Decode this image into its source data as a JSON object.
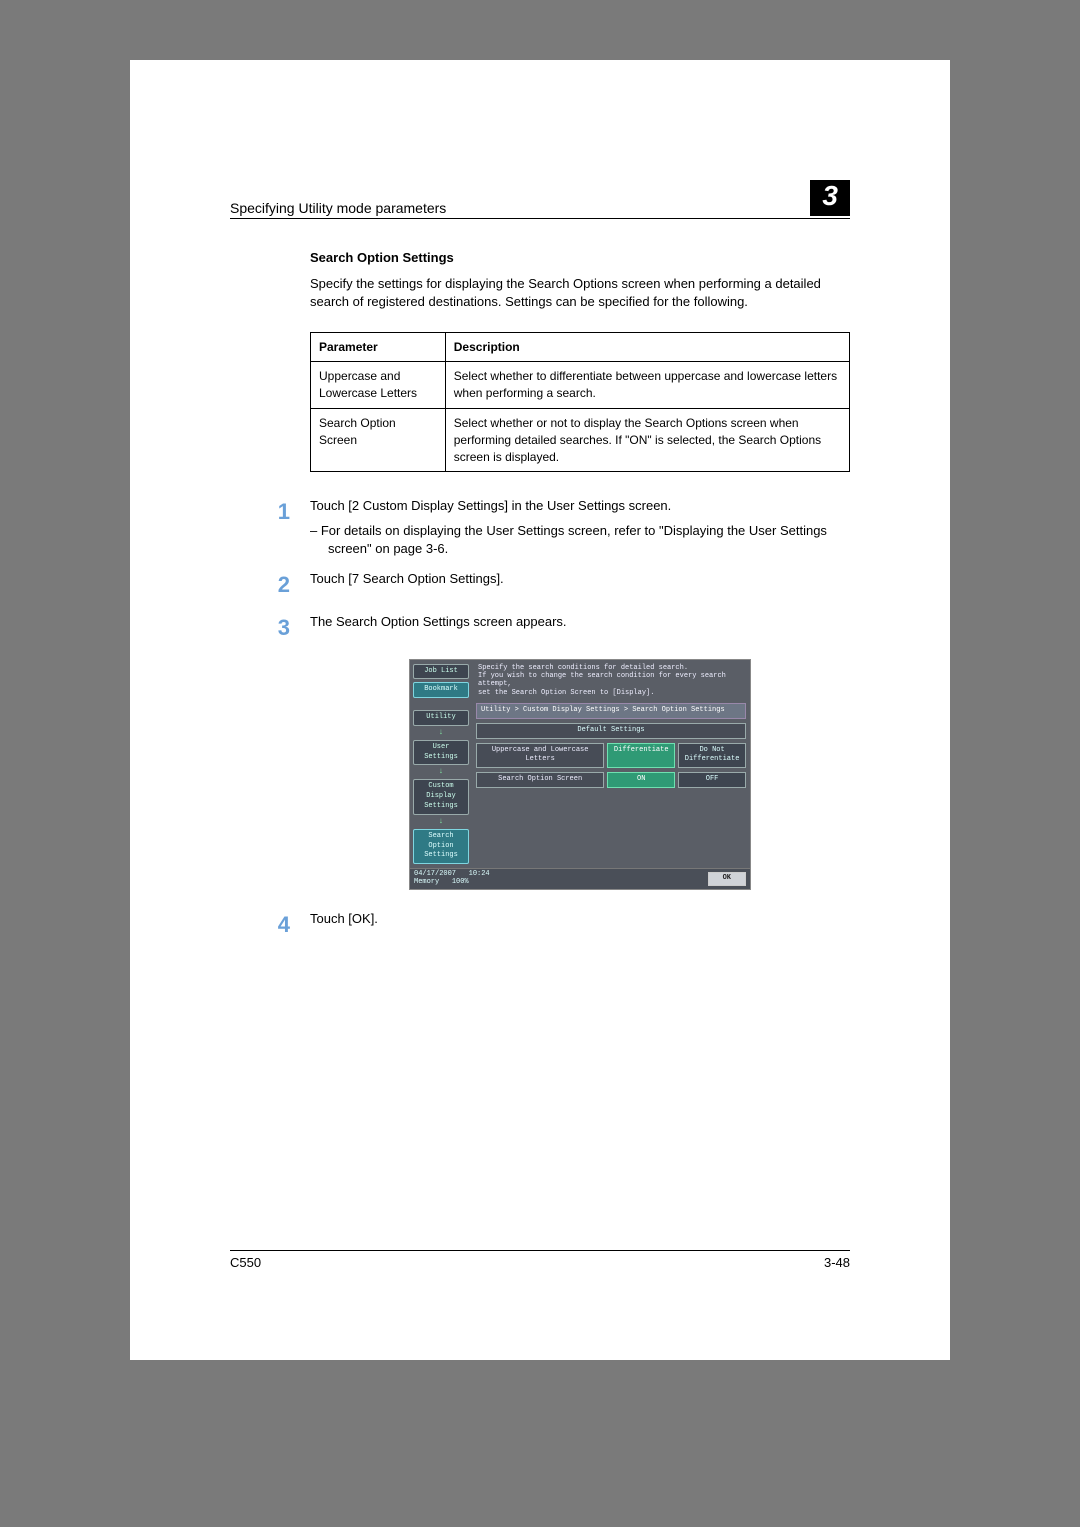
{
  "header": {
    "title": "Specifying Utility mode parameters",
    "chapter": "3"
  },
  "section": {
    "title": "Search Option Settings",
    "intro": "Specify the settings for displaying the Search Options screen when performing a detailed search of registered destinations. Settings can be specified for the following."
  },
  "table": {
    "head_param": "Parameter",
    "head_desc": "Description",
    "rows": [
      {
        "param": "Uppercase and Lowercase Letters",
        "desc": "Select whether to differentiate between uppercase and lowercase letters when performing a search."
      },
      {
        "param": "Search Option Screen",
        "desc": "Select whether or not to display the Search Options screen when performing detailed searches. If \"ON\" is selected, the Search Options screen is displayed."
      }
    ]
  },
  "steps": [
    {
      "num": "1",
      "text": "Touch [2 Custom Display Settings] in the User Settings screen.",
      "sub": "For details on displaying the User Settings screen, refer to \"Displaying the User Settings screen\" on page 3-6."
    },
    {
      "num": "2",
      "text": "Touch [7 Search Option Settings]."
    },
    {
      "num": "3",
      "text": "The Search Option Settings screen appears."
    },
    {
      "num": "4",
      "text": "Touch [OK]."
    }
  ],
  "screenshot": {
    "left_tabs": {
      "job_list": "Job List",
      "bookmark": "Bookmark",
      "utility": "Utility",
      "user_settings": "User Settings",
      "custom_display": "Custom Display Settings",
      "search_option": "Search Option Settings"
    },
    "instructions": "Specify the search conditions for detailed search.\nIf you wish to change the search condition for every search attempt,\nset the Search Option Screen to [Display].",
    "breadcrumb": "Utility > Custom Display Settings > Search Option Settings",
    "default_settings": "Default Settings",
    "row1": {
      "label": "Uppercase and Lowercase Letters",
      "opt1": "Differentiate",
      "opt2": "Do Not Differentiate"
    },
    "row2": {
      "label": "Search Option Screen",
      "opt1": "ON",
      "opt2": "OFF"
    },
    "footer": {
      "date": "04/17/2007",
      "time": "10:24",
      "memory_label": "Memory",
      "memory_value": "100%",
      "ok": "OK"
    }
  },
  "footer": {
    "model": "C550",
    "page": "3-48"
  }
}
